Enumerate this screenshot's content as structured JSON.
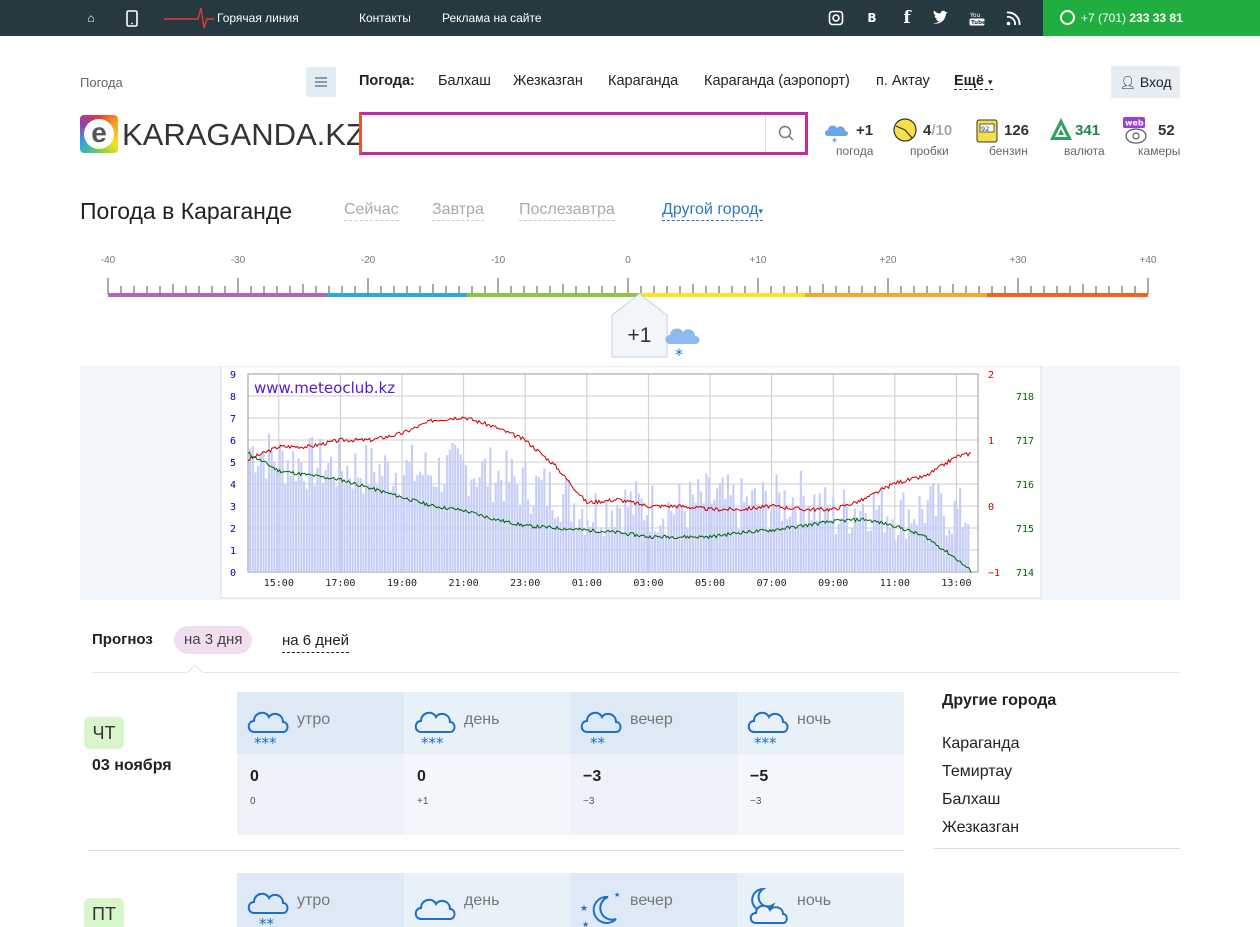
{
  "topbar": {
    "hotline_label": "Горячая линия",
    "contacts_label": "Контакты",
    "ads_label": "Реклама на сайте",
    "phone_prefix": "+7 (701)",
    "phone_number": "233 33 81",
    "social": [
      "instagram-icon",
      "vk-icon",
      "facebook-icon",
      "twitter-icon",
      "youtube-icon",
      "rss-icon"
    ]
  },
  "header": {
    "breadcrumb": "Погода",
    "nav_title": "Погода:",
    "nav_items": [
      "Балхаш",
      "Жезказган",
      "Караганда",
      "Караганда (аэропорт)",
      "п. Актау"
    ],
    "nav_more": "Ещё",
    "login_label": "Вход",
    "logo_text": "KARAGANDA.KZ",
    "logo_letter": "e",
    "search_placeholder": ""
  },
  "widgets": {
    "weather": {
      "value": "+1",
      "label": "погода"
    },
    "traffic": {
      "value": "4",
      "max": "/10",
      "label": "пробки"
    },
    "fuel": {
      "value": "126",
      "label": "бензин",
      "badge": "92"
    },
    "currency": {
      "value": "341",
      "label": "валюта"
    },
    "cameras": {
      "value": "52",
      "label": "камеры",
      "badge": "web"
    }
  },
  "weather_header": {
    "title": "Погода в Караганде",
    "tabs": [
      "Сейчас",
      "Завтра",
      "Послезавтра"
    ],
    "other_city": "Другой город"
  },
  "thermometer": {
    "scale_labels": [
      "-40",
      "-30",
      "-20",
      "-10",
      "0",
      "+10",
      "+20",
      "+30",
      "+40"
    ],
    "current_temp": "+1",
    "current_value": 1
  },
  "chart_data": {
    "type": "line",
    "title": "www.meteoclub.kz",
    "x_tick_labels": [
      "15:00",
      "17:00",
      "19:00",
      "21:00",
      "23:00",
      "01:00",
      "03:00",
      "05:00",
      "07:00",
      "09:00",
      "11:00",
      "13:00"
    ],
    "y_left_ticks": [
      "0",
      "1",
      "2",
      "3",
      "4",
      "5",
      "6",
      "7",
      "8",
      "9"
    ],
    "y_mid_ticks": [
      "2",
      "1",
      "0",
      "−1"
    ],
    "y_right_ticks": [
      "718",
      "717",
      "716",
      "715",
      "714"
    ],
    "ylim_left": [
      0,
      9
    ],
    "ylim_temp": [
      -1,
      2
    ],
    "ylim_pressure": [
      714,
      718.5
    ],
    "series": [
      {
        "color": "#cc0000",
        "axis": "temp",
        "x": [
          "14:00",
          "15:00",
          "16:00",
          "17:00",
          "18:00",
          "19:00",
          "20:00",
          "21:00",
          "22:00",
          "23:00",
          "00:00",
          "01:00",
          "02:00",
          "03:00",
          "04:00",
          "05:00",
          "06:00",
          "07:00",
          "08:00",
          "09:00",
          "10:00",
          "11:00",
          "12:00",
          "13:00",
          "13:30"
        ],
        "values": [
          0.7,
          0.9,
          0.9,
          1.0,
          1.0,
          1.1,
          1.3,
          1.35,
          1.2,
          1.0,
          0.6,
          0.05,
          0.1,
          0.0,
          0.0,
          -0.05,
          -0.05,
          0.0,
          -0.05,
          -0.05,
          0.1,
          0.35,
          0.45,
          0.75,
          0.8
        ]
      },
      {
        "color": "#006600",
        "axis": "pressure",
        "x": [
          "14:00",
          "15:00",
          "16:00",
          "17:00",
          "18:00",
          "19:00",
          "20:00",
          "21:00",
          "22:00",
          "23:00",
          "00:00",
          "01:00",
          "02:00",
          "03:00",
          "04:00",
          "05:00",
          "06:00",
          "07:00",
          "08:00",
          "09:00",
          "10:00",
          "11:00",
          "12:00",
          "13:00",
          "13:30"
        ],
        "values": [
          716.7,
          716.3,
          716.2,
          716.1,
          715.9,
          715.7,
          715.5,
          715.4,
          715.2,
          715.05,
          715.0,
          714.95,
          714.9,
          714.8,
          714.8,
          714.8,
          714.9,
          714.95,
          715.05,
          715.15,
          715.2,
          715.05,
          714.8,
          714.3,
          714.0
        ]
      },
      {
        "color": "#c4cef8",
        "axis": "left",
        "kind": "bars",
        "x": [
          "14:00",
          "15:00",
          "16:00",
          "17:00",
          "18:00",
          "19:00",
          "20:00",
          "21:00",
          "22:00",
          "23:00",
          "00:00",
          "01:00",
          "02:00",
          "03:00",
          "04:00",
          "05:00",
          "06:00",
          "07:00",
          "08:00",
          "09:00",
          "10:00",
          "11:00",
          "12:00",
          "13:00"
        ],
        "values": [
          5.5,
          5.0,
          4.8,
          4.6,
          4.5,
          4.5,
          4.4,
          4.6,
          4.3,
          3.8,
          3.5,
          2.6,
          3.0,
          2.8,
          2.8,
          3.2,
          2.9,
          3.0,
          3.3,
          2.4,
          3.0,
          2.5,
          2.8,
          2.5
        ]
      }
    ]
  },
  "forecast": {
    "label": "Прогноз",
    "tabs": [
      "на 3 дня",
      "на 6 дней"
    ],
    "days": [
      {
        "weekday": "ЧТ",
        "date": "03 ноября",
        "periods": [
          {
            "name": "утро",
            "icon": "cloud-snow-icon",
            "temp": "0",
            "feels": "0"
          },
          {
            "name": "день",
            "icon": "cloud-snow-icon",
            "temp": "0",
            "feels": "+1"
          },
          {
            "name": "вечер",
            "icon": "cloud-light-snow-icon",
            "temp": "−3",
            "feels": "−3"
          },
          {
            "name": "ночь",
            "icon": "cloud-snow-icon",
            "temp": "−5",
            "feels": "−3"
          }
        ]
      },
      {
        "weekday": "ПТ",
        "date": "",
        "periods": [
          {
            "name": "утро",
            "icon": "cloud-light-snow-icon"
          },
          {
            "name": "день",
            "icon": "cloud-icon"
          },
          {
            "name": "вечер",
            "icon": "moon-stars-icon"
          },
          {
            "name": "ночь",
            "icon": "moon-cloud-icon"
          }
        ]
      }
    ]
  },
  "other_cities": {
    "title": "Другие города",
    "items": [
      "Караганда",
      "Темиртау",
      "Балхаш",
      "Жезказган"
    ]
  }
}
